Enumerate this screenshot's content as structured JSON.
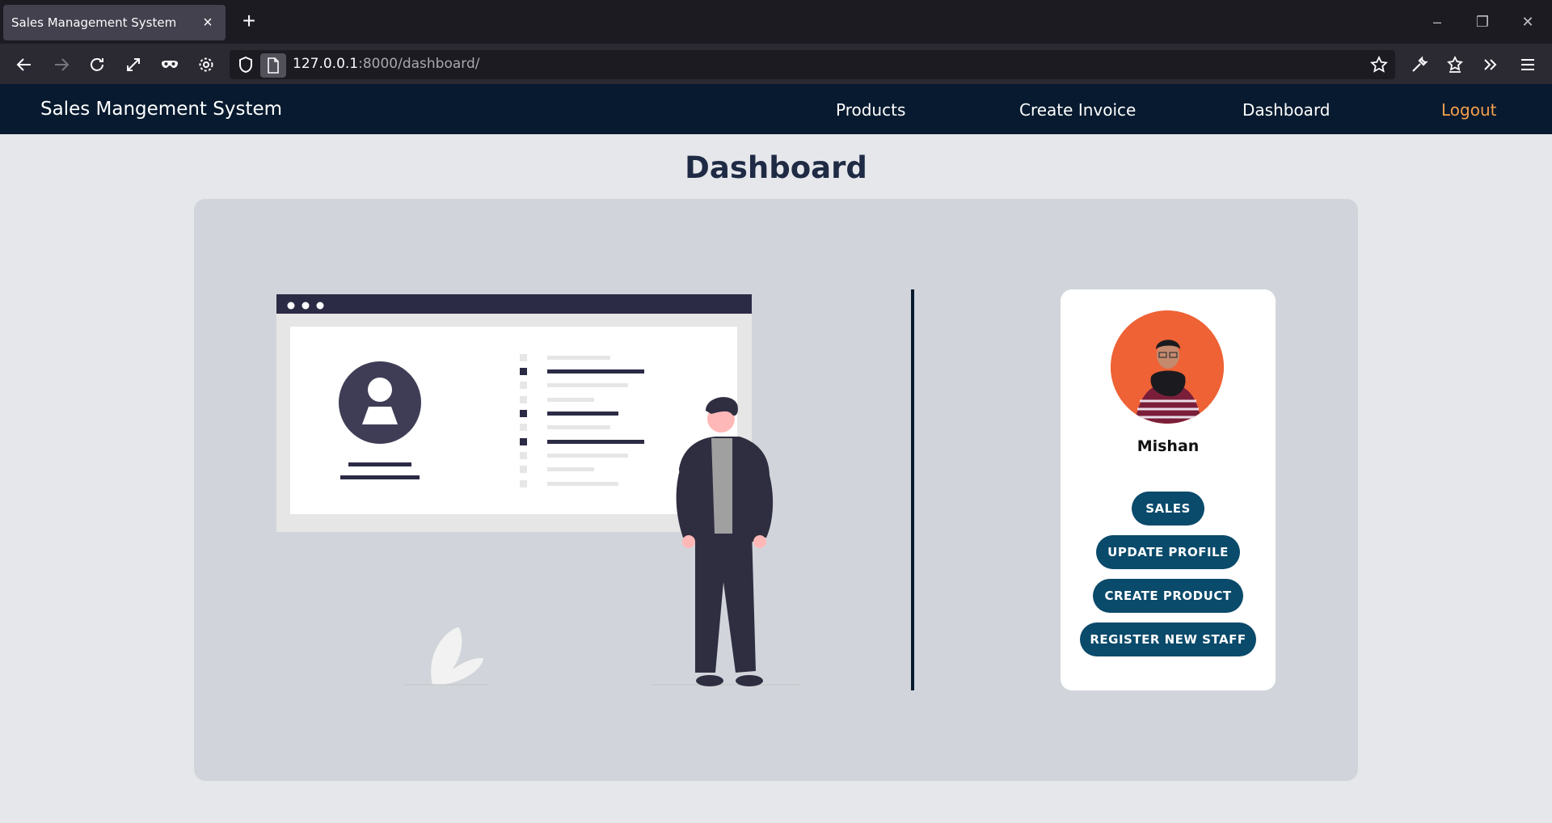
{
  "browser": {
    "tab_title": "Sales Management System",
    "tab_close": "×",
    "new_tab": "+",
    "url_host": "127.0.0.1",
    "url_rest": ":8000/dashboard/",
    "window_controls": [
      "–",
      "❐",
      "✕"
    ]
  },
  "site": {
    "brand": "Sales Mangement System",
    "nav": {
      "products": "Products",
      "create_invoice": "Create Invoice",
      "dashboard": "Dashboard",
      "logout": "Logout"
    },
    "logout_color": "#f6a04d"
  },
  "main": {
    "title": "Dashboard"
  },
  "profile": {
    "name": "Mishan",
    "buttons": {
      "sales": "SALES",
      "update_profile": "UPDATE PROFILE",
      "create_product": "CREATE PRODUCT",
      "register_staff": "REGISTER NEW STAFF"
    },
    "button_color": "#0a4a6b",
    "avatar_bg": "#ee6235"
  }
}
